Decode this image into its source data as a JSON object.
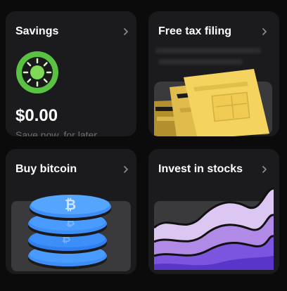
{
  "cards": {
    "savings": {
      "title": "Savings",
      "amount": "$0.00",
      "subtitle": "Save now, for later",
      "icon": "savings-wheel-icon"
    },
    "tax": {
      "title": "Free tax filing",
      "icon": "tax-documents-illustration"
    },
    "bitcoin": {
      "title": "Buy bitcoin",
      "icon": "bitcoin-coin-stack-illustration"
    },
    "stocks": {
      "title": "Invest in stocks",
      "icon": "stocks-waves-illustration"
    }
  },
  "colors": {
    "background": "#0b0b0b",
    "card": "#1b1b1d",
    "savings_green": "#5ac242",
    "tax_yellow": "#f4d35e",
    "bitcoin_blue": "#3d8ef8",
    "stocks_purple": "#7b55e0"
  }
}
